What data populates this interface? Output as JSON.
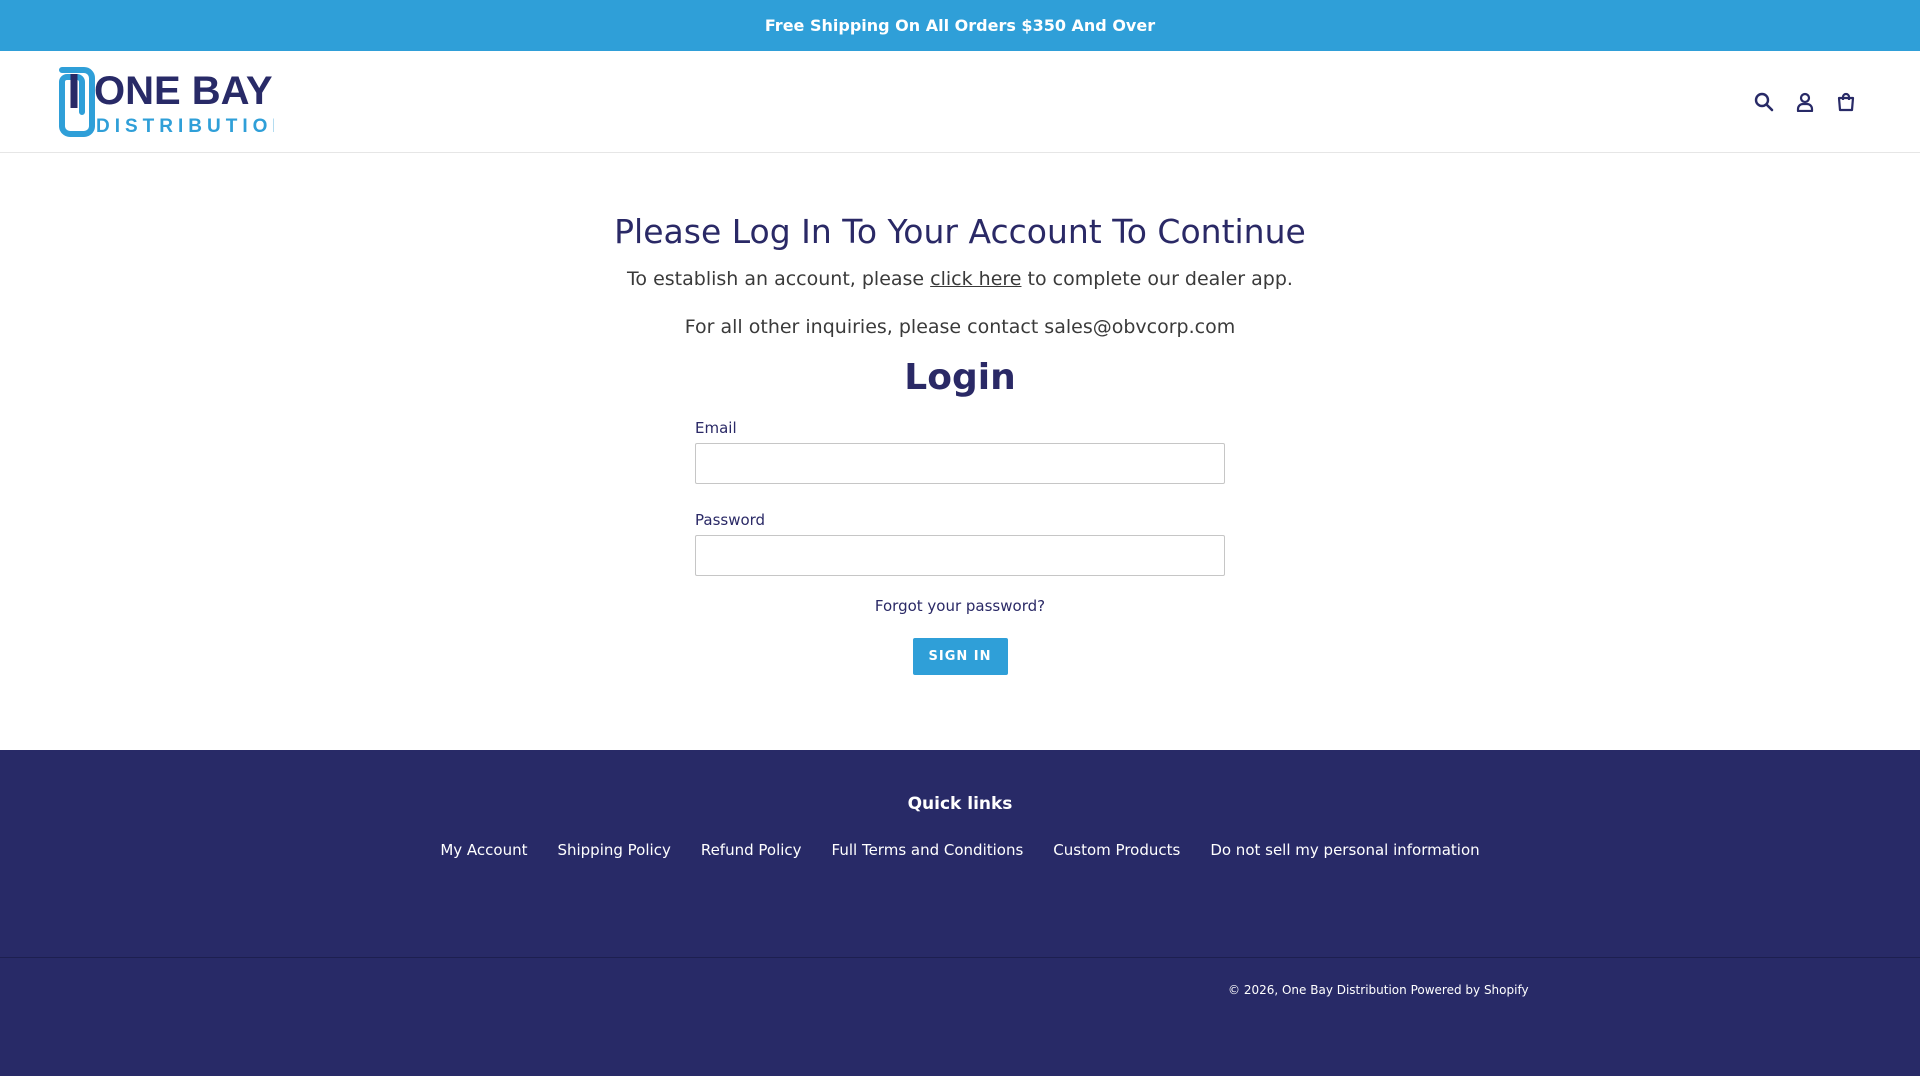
{
  "announcement": {
    "text": "Free Shipping On All Orders $350 And Over"
  },
  "header": {
    "logo": {
      "line1": "ONE BAY",
      "line2": "DISTRIBUTION"
    },
    "icons": [
      "search-icon",
      "account-icon",
      "cart-icon"
    ]
  },
  "main": {
    "title": "Please Log In To Your Account To Continue",
    "intro_before": "To establish an account, please ",
    "intro_link": "click here",
    "intro_after": " to complete our dealer app.",
    "inquiry": "For all other inquiries, please contact sales@obvcorp.com",
    "login_title": "Login",
    "email_label": "Email",
    "email_value": "",
    "password_label": "Password",
    "password_value": "",
    "forgot_label": "Forgot your password?",
    "signin_label": "SIGN IN"
  },
  "footer": {
    "quick_title": "Quick links",
    "links": [
      "My Account",
      "Shipping Policy",
      "Refund Policy",
      "Full Terms and Conditions",
      "Custom Products",
      "Do not sell my personal information"
    ],
    "copyright_prefix": "© 2026, ",
    "copyright_company": "One Bay Distribution",
    "powered_by": "Powered by Shopify"
  },
  "colors": {
    "accent": "#2f9fd8",
    "navy": "#282a67",
    "heading": "#2a2966"
  }
}
